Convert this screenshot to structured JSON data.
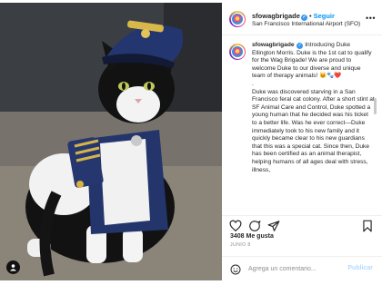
{
  "post": {
    "username": "sfowagbrigade",
    "follow_label": "Seguir",
    "location": "San Francisco International Airport (SFO)",
    "caption_username": "sfowagbrigade",
    "caption_intro": "Introducing Duke Ellington Morris. Duke is the 1st cat to qualify for the Wag Brigade! We are proud to welcome Duke to our diverse and unique team of therapy animals!",
    "caption_emojis": "🐱🐾❤️",
    "caption_dot": ".",
    "caption_body": "Duke was discovered starving in a San Francisco feral cat colony. After a short stint at SF Animal Care and Control, Duke spotted a young human that he decided was his ticket to a better life. Was he ever correct—Duke immediately took to his new family and it quickly became clear to his new guardians that this was a special cat. Since then, Duke has been certified as an animal therapist, helping humans of all ages deal with stress, illness,",
    "likes": "3408 Me gusta",
    "date": "JUNIO 8"
  },
  "comment": {
    "placeholder": "Agrega un comentario...",
    "publish_label": "Publicar"
  },
  "icons": {
    "verified": "verified-badge-icon",
    "more": "more-options-icon",
    "like": "heart-icon",
    "comment": "comment-icon",
    "share": "share-icon",
    "save": "bookmark-icon",
    "emoji": "emoji-icon",
    "tag": "user-tag-icon"
  },
  "colors": {
    "accent": "#0095f6",
    "verified": "#3897f0",
    "muted": "#8e8e8e",
    "text": "#262626"
  }
}
